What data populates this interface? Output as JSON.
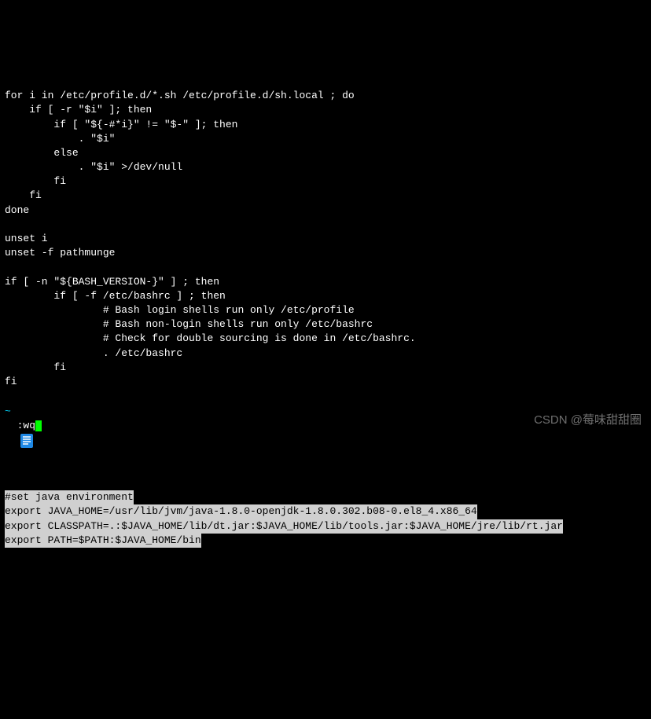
{
  "code_lines": [
    "for i in /etc/profile.d/*.sh /etc/profile.d/sh.local ; do",
    "    if [ -r \"$i\" ]; then",
    "        if [ \"${-#*i}\" != \"$-\" ]; then",
    "            . \"$i\"",
    "        else",
    "            . \"$i\" >/dev/null",
    "        fi",
    "    fi",
    "done",
    "",
    "unset i",
    "unset -f pathmunge",
    "",
    "if [ -n \"${BASH_VERSION-}\" ] ; then",
    "        if [ -f /etc/bashrc ] ; then",
    "                # Bash login shells run only /etc/profile",
    "                # Bash non-login shells run only /etc/bashrc",
    "                # Check for double sourcing is done in /etc/bashrc.",
    "                . /etc/bashrc",
    "        fi",
    "fi"
  ],
  "highlighted_lines": [
    "#set java environment",
    "export JAVA_HOME=/usr/lib/jvm/java-1.8.0-openjdk-1.8.0.302.b08-0.el8_4.x86_64",
    "export CLASSPATH=.:$JAVA_HOME/lib/dt.jar:$JAVA_HOME/lib/tools.jar:$JAVA_HOME/jre/lib/rt.jar",
    "export PATH=$PATH:$JAVA_HOME/bin"
  ],
  "tilde": "~",
  "vim_command": ":wq",
  "watermark": "CSDN @莓味甜甜圈",
  "icon": {
    "bg": "#1e88e5",
    "line": "#ffffff"
  }
}
